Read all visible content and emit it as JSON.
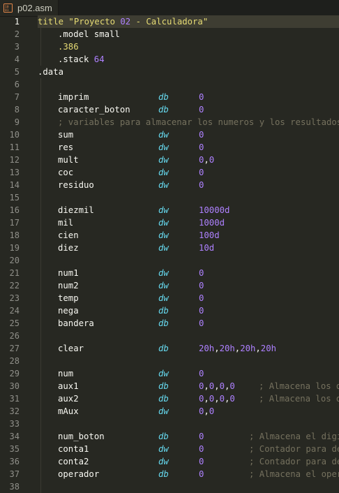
{
  "tab": {
    "icon": "binary-file-icon",
    "label": "p02.asm"
  },
  "colors": {
    "background": "#272822",
    "active_line": "#3e3d32",
    "text": "#f8f8f2",
    "string": "#e6db74",
    "keyword": "#66d9ef",
    "number": "#ae81ff",
    "comment": "#75715e",
    "gutter": "#90908a"
  },
  "lines": [
    {
      "no": "1",
      "tokens": [
        {
          "t": "title \"Proyecto ",
          "c": "str"
        },
        {
          "t": "02",
          "c": "num"
        },
        {
          "t": " - Calculadora\"",
          "c": "str"
        }
      ]
    },
    {
      "no": "2",
      "tokens": [
        {
          "t": ".model small",
          "c": "text"
        }
      ]
    },
    {
      "no": "3",
      "tokens": [
        {
          "t": ".",
          "c": "str"
        },
        {
          "t": "386",
          "c": "str"
        }
      ]
    },
    {
      "no": "4",
      "tokens": [
        {
          "t": ".stack ",
          "c": "text"
        },
        {
          "t": "64",
          "c": "num"
        }
      ]
    },
    {
      "no": "5",
      "tokens": [
        {
          "t": ".data",
          "c": "text"
        }
      ]
    },
    {
      "no": "6",
      "tokens": []
    },
    {
      "no": "7",
      "tokens": [
        {
          "t": "imprim",
          "c": "text"
        },
        {
          "t": "db",
          "c": "kw"
        },
        {
          "t": "0",
          "c": "num"
        }
      ]
    },
    {
      "no": "8",
      "tokens": [
        {
          "t": "caracter_boton",
          "c": "text"
        },
        {
          "t": "db",
          "c": "kw"
        },
        {
          "t": "0",
          "c": "num"
        }
      ]
    },
    {
      "no": "9",
      "tokens": [
        {
          "t": "; variables para almacenar los numeros y los resultados",
          "c": "com"
        }
      ]
    },
    {
      "no": "10",
      "tokens": [
        {
          "t": "sum",
          "c": "text"
        },
        {
          "t": "dw",
          "c": "kw"
        },
        {
          "t": "0",
          "c": "num"
        }
      ]
    },
    {
      "no": "11",
      "tokens": [
        {
          "t": "res",
          "c": "text"
        },
        {
          "t": "dw",
          "c": "kw"
        },
        {
          "t": "0",
          "c": "num"
        }
      ]
    },
    {
      "no": "12",
      "tokens": [
        {
          "t": "mult",
          "c": "text"
        },
        {
          "t": "dw",
          "c": "kw"
        },
        {
          "t": "0",
          "c": "num"
        },
        {
          "t": ",",
          "c": "text"
        },
        {
          "t": "0",
          "c": "num"
        }
      ]
    },
    {
      "no": "13",
      "tokens": [
        {
          "t": "coc",
          "c": "text"
        },
        {
          "t": "dw",
          "c": "kw"
        },
        {
          "t": "0",
          "c": "num"
        }
      ]
    },
    {
      "no": "14",
      "tokens": [
        {
          "t": "residuo",
          "c": "text"
        },
        {
          "t": "dw",
          "c": "kw"
        },
        {
          "t": "0",
          "c": "num"
        }
      ]
    },
    {
      "no": "15",
      "tokens": []
    },
    {
      "no": "16",
      "tokens": [
        {
          "t": "diezmil",
          "c": "text"
        },
        {
          "t": "dw",
          "c": "kw"
        },
        {
          "t": "10000d",
          "c": "num"
        }
      ]
    },
    {
      "no": "17",
      "tokens": [
        {
          "t": "mil",
          "c": "text"
        },
        {
          "t": "dw",
          "c": "kw"
        },
        {
          "t": "1000d",
          "c": "num"
        }
      ]
    },
    {
      "no": "18",
      "tokens": [
        {
          "t": "cien",
          "c": "text"
        },
        {
          "t": "dw",
          "c": "kw"
        },
        {
          "t": "100d",
          "c": "num"
        }
      ]
    },
    {
      "no": "19",
      "tokens": [
        {
          "t": "diez",
          "c": "text"
        },
        {
          "t": "dw",
          "c": "kw"
        },
        {
          "t": "10d",
          "c": "num"
        }
      ]
    },
    {
      "no": "20",
      "tokens": []
    },
    {
      "no": "21",
      "tokens": [
        {
          "t": "num1",
          "c": "text"
        },
        {
          "t": "dw",
          "c": "kw"
        },
        {
          "t": "0",
          "c": "num"
        }
      ]
    },
    {
      "no": "22",
      "tokens": [
        {
          "t": "num2",
          "c": "text"
        },
        {
          "t": "dw",
          "c": "kw"
        },
        {
          "t": "0",
          "c": "num"
        }
      ]
    },
    {
      "no": "23",
      "tokens": [
        {
          "t": "temp",
          "c": "text"
        },
        {
          "t": "dw",
          "c": "kw"
        },
        {
          "t": "0",
          "c": "num"
        }
      ]
    },
    {
      "no": "24",
      "tokens": [
        {
          "t": "nega",
          "c": "text"
        },
        {
          "t": "db",
          "c": "kw"
        },
        {
          "t": "0",
          "c": "num"
        }
      ]
    },
    {
      "no": "25",
      "tokens": [
        {
          "t": "bandera",
          "c": "text"
        },
        {
          "t": "db",
          "c": "kw"
        },
        {
          "t": "0",
          "c": "num"
        }
      ]
    },
    {
      "no": "26",
      "tokens": []
    },
    {
      "no": "27",
      "tokens": [
        {
          "t": "clear",
          "c": "text"
        },
        {
          "t": "db",
          "c": "kw"
        },
        {
          "t": "20h",
          "c": "num"
        },
        {
          "t": ",",
          "c": "text"
        },
        {
          "t": "20h",
          "c": "num"
        },
        {
          "t": ",",
          "c": "text"
        },
        {
          "t": "20h",
          "c": "num"
        },
        {
          "t": ",",
          "c": "text"
        },
        {
          "t": "20h",
          "c": "num"
        }
      ]
    },
    {
      "no": "28",
      "tokens": []
    },
    {
      "no": "29",
      "tokens": [
        {
          "t": "num",
          "c": "text"
        },
        {
          "t": "dw",
          "c": "kw"
        },
        {
          "t": "0",
          "c": "num"
        }
      ]
    },
    {
      "no": "30",
      "tokens": [
        {
          "t": "aux1",
          "c": "text"
        },
        {
          "t": "db",
          "c": "kw"
        },
        {
          "t": "0",
          "c": "num"
        },
        {
          "t": ",",
          "c": "text"
        },
        {
          "t": "0",
          "c": "num"
        },
        {
          "t": ",",
          "c": "text"
        },
        {
          "t": "0",
          "c": "num"
        },
        {
          "t": ",",
          "c": "text"
        },
        {
          "t": "0",
          "c": "num"
        },
        {
          "t": "; Almacena los dig",
          "c": "com"
        }
      ]
    },
    {
      "no": "31",
      "tokens": [
        {
          "t": "aux2",
          "c": "text"
        },
        {
          "t": "db",
          "c": "kw"
        },
        {
          "t": "0",
          "c": "num"
        },
        {
          "t": ",",
          "c": "text"
        },
        {
          "t": "0",
          "c": "num"
        },
        {
          "t": ",",
          "c": "text"
        },
        {
          "t": "0",
          "c": "num"
        },
        {
          "t": ",",
          "c": "text"
        },
        {
          "t": "0",
          "c": "num"
        },
        {
          "t": "; Almacena los dig",
          "c": "com"
        }
      ]
    },
    {
      "no": "32",
      "tokens": [
        {
          "t": "mAux",
          "c": "text"
        },
        {
          "t": "dw",
          "c": "kw"
        },
        {
          "t": "0",
          "c": "num"
        },
        {
          "t": ",",
          "c": "text"
        },
        {
          "t": "0",
          "c": "num"
        }
      ]
    },
    {
      "no": "33",
      "tokens": []
    },
    {
      "no": "34",
      "tokens": [
        {
          "t": "num_boton",
          "c": "text"
        },
        {
          "t": "db",
          "c": "kw"
        },
        {
          "t": "0",
          "c": "num"
        },
        {
          "t": "; Almacena el digi",
          "c": "com"
        }
      ]
    },
    {
      "no": "35",
      "tokens": [
        {
          "t": "conta1",
          "c": "text"
        },
        {
          "t": "dw",
          "c": "kw"
        },
        {
          "t": "0",
          "c": "num"
        },
        {
          "t": "; Contador para de",
          "c": "com"
        }
      ]
    },
    {
      "no": "36",
      "tokens": [
        {
          "t": "conta2",
          "c": "text"
        },
        {
          "t": "dw",
          "c": "kw"
        },
        {
          "t": "0",
          "c": "num"
        },
        {
          "t": "; Contador para de",
          "c": "com"
        }
      ]
    },
    {
      "no": "37",
      "tokens": [
        {
          "t": "operador",
          "c": "text"
        },
        {
          "t": "db",
          "c": "kw"
        },
        {
          "t": "0",
          "c": "num"
        },
        {
          "t": "; Almacena el oper",
          "c": "com"
        }
      ]
    },
    {
      "no": "38",
      "tokens": []
    }
  ]
}
